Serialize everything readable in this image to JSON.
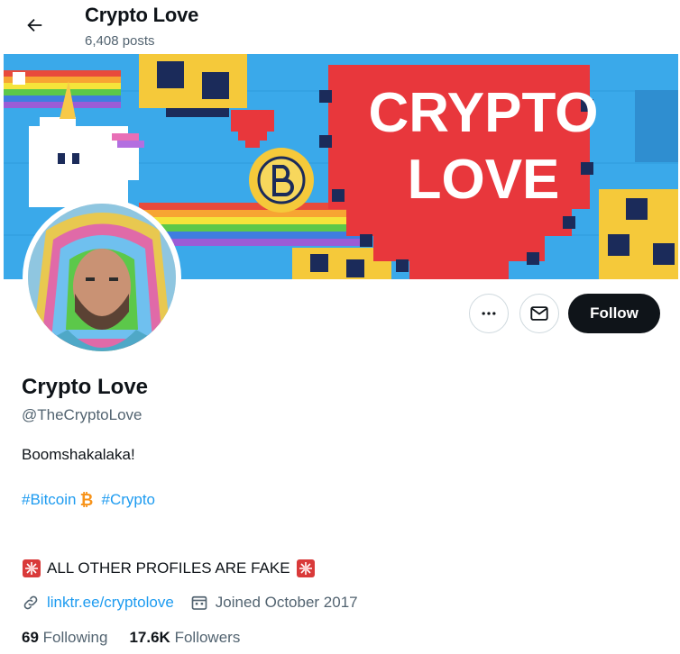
{
  "header": {
    "title": "Crypto Love",
    "post_count": "6,408 posts"
  },
  "banner": {
    "heading_line1": "CRYPTO",
    "heading_line2": "LOVE"
  },
  "actions": {
    "follow_label": "Follow"
  },
  "profile": {
    "name": "Crypto Love",
    "handle": "@TheCryptoLove",
    "bio": "Boomshakalaka!",
    "hashtag_1": "#Bitcoin",
    "hashtag_2": "#Crypto",
    "warning": "ALL OTHER PROFILES ARE FAKE",
    "link": "linktr.ee/cryptolove",
    "joined": "Joined October 2017"
  },
  "stats": {
    "following_count": "69",
    "following_label": "Following",
    "followers_count": "17.6K",
    "followers_label": "Followers"
  },
  "icons": {
    "back": "arrow-left-icon",
    "more": "more-icon",
    "message": "envelope-icon",
    "link": "link-icon",
    "calendar": "calendar-icon",
    "bitcoin": "bitcoin-icon",
    "siren": "siren-icon"
  },
  "colors": {
    "accent": "#1d9bf0",
    "text": "#0f1419",
    "muted": "#536471",
    "button_dark": "#0f1419",
    "banner_sky": "#3aa9ea",
    "banner_heart": "#e8373c"
  }
}
